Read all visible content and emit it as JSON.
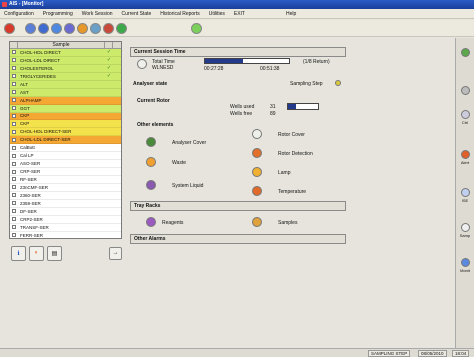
{
  "window": {
    "title": "AIS - [Monitor]"
  },
  "menu": [
    "Configuration",
    "Programming",
    "Work Session",
    "Current State",
    "Historical Reports",
    "Utilities",
    "EXIT",
    "Help"
  ],
  "toolbar_icons": [
    "stop-red-icon",
    "settings-blue-icon",
    "sample-blue-icon",
    "check-blue-icon",
    "reagent-blue-icon",
    "flag-orange-icon",
    "globe-icon",
    "lock-icon",
    "green-go-icon",
    "status-green-icon"
  ],
  "samples": {
    "header": "Sample",
    "rows": [
      {
        "name": "CHOL-HDL DIRECT",
        "color": "g",
        "ok": "✓"
      },
      {
        "name": "CHOL-LDL DIRECT",
        "color": "g",
        "ok": "✓"
      },
      {
        "name": "CHOLESTEROL",
        "color": "g",
        "ok": "✓"
      },
      {
        "name": "TRIGLYCERIDES",
        "color": "g",
        "ok": "✓"
      },
      {
        "name": "ALT",
        "color": "g",
        "ok": ""
      },
      {
        "name": "AST",
        "color": "g",
        "ok": ""
      },
      {
        "name": "ALPHAMP",
        "color": "o",
        "ok": ""
      },
      {
        "name": "GGT",
        "color": "g",
        "ok": ""
      },
      {
        "name": "CKP",
        "color": "o",
        "ok": ""
      },
      {
        "name": "CKP",
        "color": "y",
        "ok": ""
      },
      {
        "name": "CHOL-HDL DIRECT-SER",
        "color": "y",
        "ok": ""
      },
      {
        "name": "CHOL-LDL DIRECT-SER",
        "color": "o",
        "ok": ""
      },
      {
        "name": "CalBott",
        "color": "w",
        "ok": ""
      },
      {
        "name": "Cal LP",
        "color": "w",
        "ok": ""
      },
      {
        "name": "ASO-SER",
        "color": "w",
        "ok": ""
      },
      {
        "name": "CRP-SER",
        "color": "w",
        "ok": ""
      },
      {
        "name": "RF-SER",
        "color": "w",
        "ok": ""
      },
      {
        "name": "23nCMF-SER",
        "color": "w",
        "ok": ""
      },
      {
        "name": "2360-SER",
        "color": "w",
        "ok": ""
      },
      {
        "name": "2359-SER",
        "color": "w",
        "ok": ""
      },
      {
        "name": "DF-SER",
        "color": "w",
        "ok": ""
      },
      {
        "name": "CRP2-SER",
        "color": "w",
        "ok": ""
      },
      {
        "name": "TRANSF-SER",
        "color": "w",
        "ok": ""
      },
      {
        "name": "FERR-SER",
        "color": "w",
        "ok": ""
      }
    ]
  },
  "left_buttons": [
    "info-icon",
    "color-wheel-icon",
    "print-icon",
    "arrow-right-icon"
  ],
  "session": {
    "header": "Current Session Time",
    "total_label": "Total Time",
    "total_sub": "WLNESD",
    "time1": "00:27:28",
    "time2": "00:51:38",
    "progress": 0.45,
    "returns": "(1/8 Return)"
  },
  "analyser": {
    "header": "Analyser state",
    "status": "Sampling Step"
  },
  "rotor": {
    "header": "Current Rotor",
    "wells_used_label": "Wells used",
    "wells_used": "31",
    "wells_free_label": "Wells free",
    "wells_free": "89",
    "fill": 0.26
  },
  "other_elements": {
    "header": "Other elements",
    "items": [
      {
        "label": "Analyser Cover",
        "icon": "analyser-cover-icon"
      },
      {
        "label": "Rotor Cover",
        "icon": "rotor-cover-icon"
      },
      {
        "label": "Waste",
        "icon": "waste-icon"
      },
      {
        "label": "Rotor Detection",
        "icon": "rotor-detection-icon"
      },
      {
        "label": "System Liquid",
        "icon": "system-liquid-icon"
      },
      {
        "label": "Lamp",
        "icon": "lamp-icon"
      },
      {
        "label": "Temperature",
        "icon": "temperature-icon"
      }
    ]
  },
  "tray_racks": {
    "header": "Tray Racks",
    "reagents": "Reagents",
    "samples": "Samples"
  },
  "other_alarms": {
    "header": "Other Alarms"
  },
  "right_bar": [
    {
      "label": "Ctrl"
    },
    {
      "label": "Alert"
    },
    {
      "label": "ISE"
    },
    {
      "label": "Samp"
    },
    {
      "label": "Monit"
    }
  ],
  "statusbar": {
    "state": "SAMPLING STEP",
    "date": "08/05/2010",
    "time": "18:04"
  },
  "colors": {
    "green": "#cdea6a",
    "orange": "#f4a833",
    "yellow": "#f3e24b",
    "titlebar": "#1b3f9a"
  }
}
